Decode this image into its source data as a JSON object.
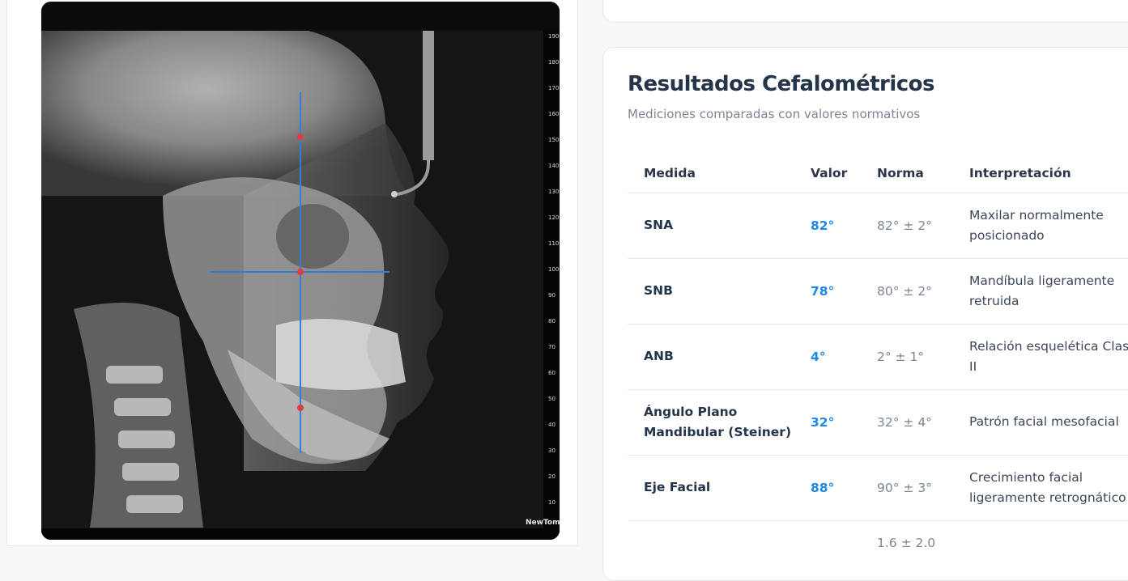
{
  "xray": {
    "ruler_labels": [
      "190",
      "180",
      "170",
      "160",
      "150",
      "140",
      "130",
      "120",
      "110",
      "100",
      "90",
      "80",
      "70",
      "60",
      "50",
      "40",
      "30",
      "20",
      "10"
    ],
    "brand": "NewTom",
    "accent_line": "#2f7fd8",
    "landmark_color": "#e23c3c"
  },
  "results": {
    "title": "Resultados Cefalométricos",
    "subtitle": "Mediciones comparadas con valores normativos",
    "headers": {
      "measure": "Medida",
      "value": "Valor",
      "norm": "Norma",
      "interpretation": "Interpretación"
    },
    "rows": [
      {
        "measure": "SNA",
        "value": "82°",
        "norm": "82° ± 2°",
        "interpretation": "Maxilar normalmente posicionado"
      },
      {
        "measure": "SNB",
        "value": "78°",
        "norm": "80° ± 2°",
        "interpretation": "Mandíbula ligeramente retruida"
      },
      {
        "measure": "ANB",
        "value": "4°",
        "norm": "2° ± 1°",
        "interpretation": "Relación esquelética Clase II"
      },
      {
        "measure": "Ángulo Plano Mandibular (Steiner)",
        "value": "32°",
        "norm": "32° ± 4°",
        "interpretation": "Patrón facial mesofacial"
      },
      {
        "measure": "Eje Facial",
        "value": "88°",
        "norm": "90° ± 3°",
        "interpretation": "Crecimiento facial ligeramente retrognático"
      },
      {
        "measure": "",
        "value": "",
        "norm": "1.6 ± 2.0",
        "interpretation": ""
      }
    ],
    "value_color": "#1e88e5"
  }
}
